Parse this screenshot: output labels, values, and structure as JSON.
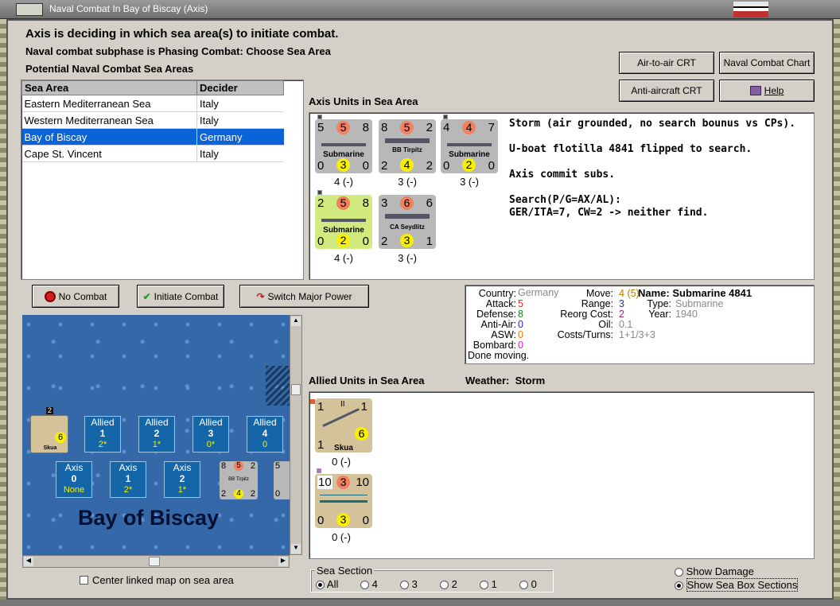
{
  "window": {
    "title": "Naval Combat In Bay of Biscay (Axis)"
  },
  "header": {
    "status": "Axis is deciding in which sea area(s) to initiate combat.",
    "subphase": "Naval combat subphase is Phasing Combat: Choose Sea Area",
    "potential_label": "Potential Naval Combat Sea Areas"
  },
  "top_buttons": {
    "air_crt": "Air-to-air CRT",
    "naval_chart": "Naval Combat Chart",
    "aa_crt": "Anti-aircraft CRT",
    "help": "Help"
  },
  "sea_table": {
    "columns": [
      "Sea Area",
      "Decider"
    ],
    "rows": [
      {
        "area": "Eastern Mediterranean Sea",
        "decider": "Italy"
      },
      {
        "area": "Western Mediterranean Sea",
        "decider": "Italy"
      },
      {
        "area": "Bay of Biscay",
        "decider": "Germany",
        "selected": true
      },
      {
        "area": "Cape St. Vincent",
        "decider": "Italy"
      }
    ]
  },
  "axis_units": {
    "label": "Axis Units in Sea Area",
    "units": [
      {
        "name": "Submarine",
        "tl": "5",
        "tc": "5",
        "tr": "8",
        "bl": "0",
        "bc": "3",
        "br": "0",
        "under": "4 (-)"
      },
      {
        "name": "BB Tirpitz",
        "tl": "8",
        "tc": "5",
        "tr": "2",
        "bl": "2",
        "bc": "4",
        "br": "2",
        "under": "3 (-)"
      },
      {
        "name": "Submarine",
        "tl": "4",
        "tc": "4",
        "tr": "7",
        "bl": "0",
        "bc": "2",
        "br": "0",
        "under": "3 (-)"
      },
      {
        "name": "Submarine",
        "tl": "2",
        "tc": "5",
        "tr": "8",
        "bl": "0",
        "bc": "2",
        "br": "0",
        "under": "4 (-)"
      },
      {
        "name": "CA Seydlitz",
        "tl": "3",
        "tc": "6",
        "tr": "6",
        "bl": "2",
        "bc": "3",
        "br": "1",
        "under": "3 (-)"
      }
    ]
  },
  "log": {
    "lines": [
      "Storm (air grounded, no search bounus vs CPs).",
      "U-boat flotilla 4841 flipped to search.",
      "Axis commit subs.",
      "Search(P/G=AX/AL):",
      "GER/ITA=7, CW=2 -> neither find."
    ]
  },
  "action_buttons": {
    "no_combat": "No Combat",
    "initiate": "Initiate Combat",
    "switch": "Switch Major Power"
  },
  "details": {
    "country_label": "Country:",
    "country": "Germany",
    "attack_label": "Attack:",
    "attack": "5",
    "defense_label": "Defense:",
    "defense": "8",
    "aa_label": "Anti-Air:",
    "aa": "0",
    "asw_label": "ASW:",
    "asw": "0",
    "bombard_label": "Bombard:",
    "bombard": "0",
    "status": "Done moving.",
    "name_label": "Name:",
    "name": "Submarine 4841",
    "move_label": "Move:",
    "move": "4",
    "move_paren": "(5)",
    "type_label": "Type:",
    "type": "Submarine",
    "range_label": "Range:",
    "range": "3",
    "year_label": "Year:",
    "year": "1940",
    "reorg_label": "Reorg Cost:",
    "reorg": "2",
    "oil_label": "Oil:",
    "oil": "0.1",
    "costs_label": "Costs/Turns:",
    "costs": "1+1/3+3"
  },
  "allied": {
    "label": "Allied Units in Sea Area",
    "weather_label": "Weather:",
    "weather": "Storm",
    "units": [
      {
        "name": "Skua",
        "tl": "1",
        "tr": "1",
        "mark": "II",
        "bl": "1",
        "bc": "6",
        "under": "0 (-)"
      },
      {
        "name": "",
        "tl": "10",
        "tc": "3",
        "tr": "10",
        "bl": "0",
        "bc": "3",
        "br": "0",
        "under": "0 (-)"
      }
    ]
  },
  "map": {
    "title": "Bay of Biscay",
    "allied_boxes": [
      {
        "label": "Allied",
        "num": "1",
        "sub": "2*"
      },
      {
        "label": "Allied",
        "num": "2",
        "sub": "1*"
      },
      {
        "label": "Allied",
        "num": "3",
        "sub": "0*"
      },
      {
        "label": "Allied",
        "num": "4",
        "sub": "0"
      }
    ],
    "axis_boxes": [
      {
        "label": "Axis",
        "num": "0",
        "sub": "None"
      },
      {
        "label": "Axis",
        "num": "1",
        "sub": "2*"
      },
      {
        "label": "Axis",
        "num": "2",
        "sub": "1*"
      }
    ],
    "skua_badge": "2",
    "skua_name": "Skua",
    "skua_val": "6",
    "tirpitz": {
      "badge": "3",
      "tl": "8",
      "tc": "5",
      "tr": "2",
      "bl": "2",
      "bc": "4",
      "br": "2",
      "name": "BB Tirpitz"
    },
    "partial": {
      "tl": "5",
      "bl": "0"
    }
  },
  "center_checkbox": "Center linked map on sea area",
  "sea_section": {
    "label": "Sea Section",
    "options": [
      "All",
      "4",
      "3",
      "2",
      "1",
      "0"
    ],
    "selected": "All"
  },
  "show_damage": "Show Damage",
  "show_boxes": "Show Sea Box Sections",
  "colors": {
    "selected": "#0a64d8",
    "attack": "#e03020",
    "defense": "#208020",
    "aa": "#2030c0",
    "reorg": "#a02080",
    "oil": "#888888"
  }
}
